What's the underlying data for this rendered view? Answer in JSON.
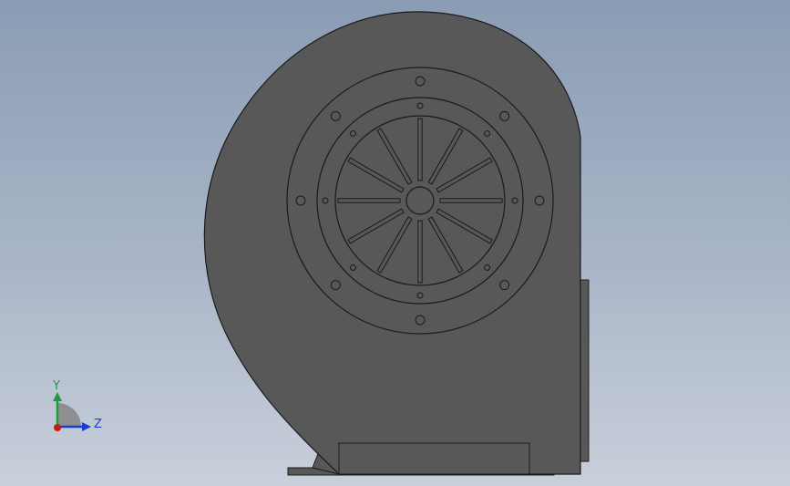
{
  "viewport": {
    "background_top": "#8a9cb4",
    "background_bottom": "#c9cfdb"
  },
  "model": {
    "housing_color": "#585858",
    "edge_color": "#1a1a1a",
    "impeller_blade_count": 12,
    "outer_flange_hole_count": 8,
    "inner_ring_hole_count": 8
  },
  "triad": {
    "y_label": "Y",
    "z_label": "Z",
    "y_color": "#1f9a3a",
    "z_color": "#1a3fd0",
    "origin_color": "#d01818"
  }
}
